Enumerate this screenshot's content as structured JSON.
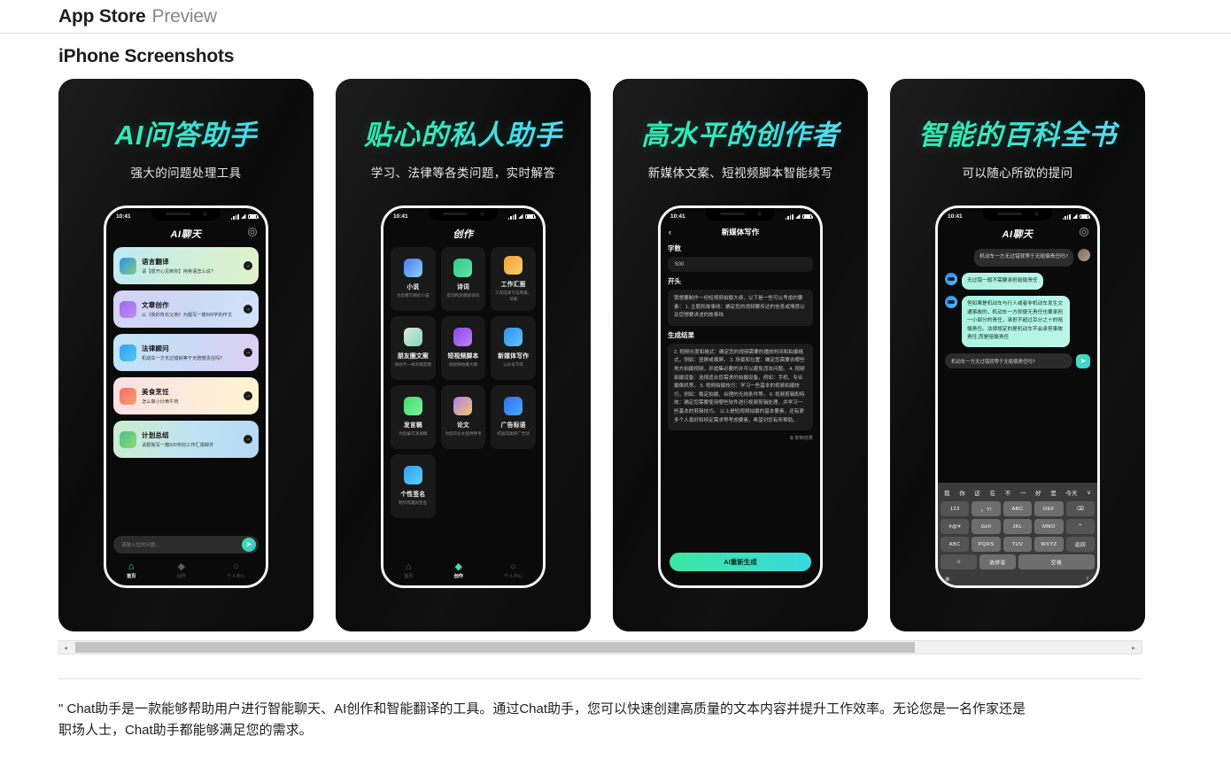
{
  "header": {
    "brand": "App Store",
    "preview": "Preview"
  },
  "section": {
    "title": "iPhone Screenshots"
  },
  "scrollbar": {
    "left_arrow": "◂",
    "right_arrow": "▸"
  },
  "description": "\" Chat助手是一款能够帮助用户进行智能聊天、AI创作和智能翻译的工具。通过Chat助手，您可以快速创建高质量的文本内容并提升工作效率。无论您是一名作家还是职场人士，Chat助手都能够满足您的需求。",
  "status": {
    "time": "10:41",
    "wifi": "▼",
    "battery": "full"
  },
  "shots": [
    {
      "promo_title": "AI问答助手",
      "promo_sub": "强大的问题处理工具",
      "app_title": "AI聊天",
      "gear": "gear-icon",
      "cards": [
        {
          "title": "语言翻译",
          "sub": "请【很开心见到你】用英语怎么说?",
          "arrow": "→"
        },
        {
          "title": "文章创作",
          "sub": "以《我的背长父亲》为题写一篇500字的作文",
          "arrow": "→"
        },
        {
          "title": "法律顾问",
          "sub": "机动车一方无过错就等于无赔偿责任吗?",
          "arrow": "→"
        },
        {
          "title": "美食烹饪",
          "sub": "怎么做小炒黄牛肉",
          "arrow": "→"
        },
        {
          "title": "计划总结",
          "sub": "请帮我写一篇500字的工作汇报邮件",
          "arrow": "→"
        }
      ],
      "composer_placeholder": "请输入您的问题...",
      "send_icon": "➤",
      "tabs": [
        {
          "label": "首页",
          "icon": "⌂",
          "active": true
        },
        {
          "label": "创作",
          "icon": "◆",
          "active": false
        },
        {
          "label": "个人中心",
          "icon": "○",
          "active": false
        }
      ]
    },
    {
      "promo_title": "贴心的私人助手",
      "promo_sub": "学习、法律等各类问题，实时解答",
      "app_title": "创作",
      "grid": [
        {
          "title": "小说",
          "sub": "为您模写精彩小说"
        },
        {
          "title": "诗词",
          "sub": "帮您构思模索诗词"
        },
        {
          "title": "工作汇报",
          "sub": "工作成果写成周报、日报"
        },
        {
          "title": "朋友圈文案",
          "sub": "体验不一样的朋友圈"
        },
        {
          "title": "短视频脚本",
          "sub": "短视频拍摄大纲"
        },
        {
          "title": "新媒体写作",
          "sub": "公众号写作"
        },
        {
          "title": "发言稿",
          "sub": "为您编写演讲稿"
        },
        {
          "title": "论文",
          "sub": "为您的论文提供参考"
        },
        {
          "title": "广告标语",
          "sub": "校准同类的广告语"
        },
        {
          "title": "个性签名",
          "sub": "制作有趣的签名"
        }
      ],
      "tabs": [
        {
          "label": "首页",
          "icon": "⌂",
          "active": false
        },
        {
          "label": "创作",
          "icon": "◆",
          "active": true
        },
        {
          "label": "个人中心",
          "icon": "○",
          "active": false
        }
      ]
    },
    {
      "promo_title": "高水平的创作者",
      "promo_sub": "新媒体文案、短视频脚本智能续写",
      "nav_title": "新媒体写作",
      "back_icon": "‹",
      "label_count": "字数",
      "value_count": "500",
      "label_open": "开头",
      "value_open": "我想要制作一份短视频拍摄大纲，以下是一些可以考虑的要素：\n1. 主题和故事线：确定您的视频要传达的信息或情感以及您想要讲述的故事线",
      "label_result": "生成结果",
      "value_result": "2. 视频长度和格式：确定您的视频需要的播放时间和拍摄格式，例如：竖屏或横屏。\n3. 场景和位置：确定您需要去哪些地方拍摄视频，并搶集必要的许可以避免违法问题。\n4. 视频拍摄设备：选择适合您需求的拍摄设备，例如：手机、专业摄像机等。\n5. 视频拍摄技巧：学习一些基本的视频拍摄技巧，例如：稳定拍摄、合理的光线条件等。\n6. 视频剪辑和特效：确定您需要使用哪些软件进行视频剪辑处理，并学习一些基本的剪辑技巧。\n以上是短视频拍摄的基本要素，还有更多个人喜好和特定需求等考虑要素，希望对您有所帮助。",
      "copy_label": "复制结果",
      "copy_icon": "⧉",
      "generate_button": "AI重新生成"
    },
    {
      "promo_title": "智能的百科全书",
      "promo_sub": "可以随心所欲的提问",
      "app_title": "AI聊天",
      "messages": [
        {
          "from": "user",
          "text": "机动车一方无过错就等于无赔偿责任吗?"
        },
        {
          "from": "ai",
          "text": "无过错一般不需要承担赔偿责任"
        },
        {
          "from": "ai",
          "text": "但如果是机动车与行人或者非机动车发生交通事故的，机动车一方即便无责任也要承担一小部分的责任，承担不超过百分之十的赔偿责任。法律规定的是机动车不会承担事故责任,而是赔偿责任"
        }
      ],
      "input_value": "机动车一方无过错就等于无赔偿责任吗?",
      "send_icon": "➤",
      "keyboard": {
        "suggestions": [
          "我",
          "你",
          "这",
          "在",
          "不",
          "一",
          "好",
          "是",
          "今天"
        ],
        "suggest_chevron": "∨",
        "rows": [
          [
            "123",
            "。?!",
            "ABC",
            "DEF",
            "⌫"
          ],
          [
            "#@¥",
            "GHI",
            "JKL",
            "MNO",
            "⌃"
          ],
          [
            "ABC",
            "PQRS",
            "TUV",
            "WXYZ",
            "返回"
          ],
          [
            "☺",
            "选拼音",
            "空格"
          ]
        ],
        "globe_icon": "⊕",
        "mic_icon": "♇"
      }
    }
  ]
}
